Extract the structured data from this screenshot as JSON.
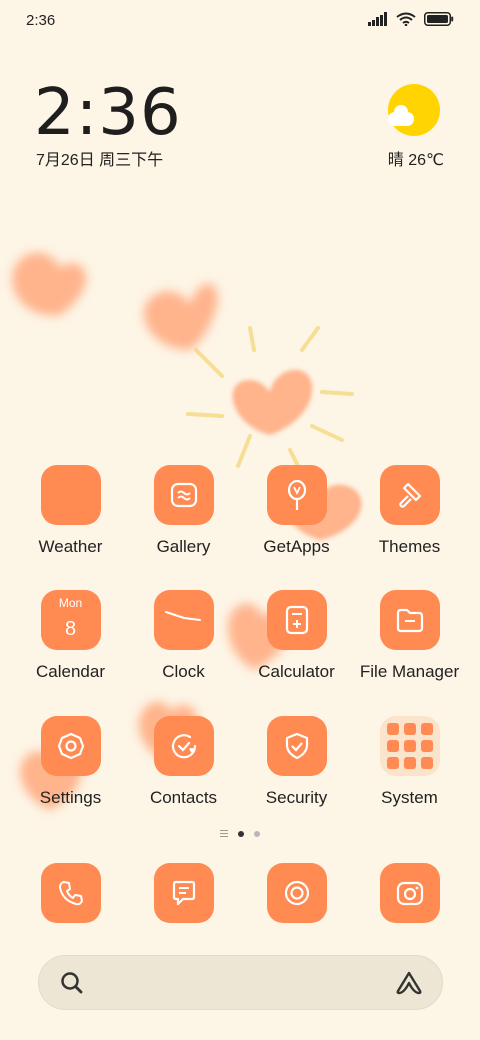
{
  "status_bar": {
    "time": "2:36",
    "signal_icon": "signal-icon",
    "wifi_icon": "wifi-icon",
    "battery_icon": "battery-icon"
  },
  "clock_widget": {
    "time": "2:36",
    "date": "7月26日 周三下午"
  },
  "weather_widget": {
    "icon": "partly-sunny-icon",
    "text": "晴 26℃"
  },
  "apps": [
    {
      "label": "Weather",
      "icon": "weather-icon"
    },
    {
      "label": "Gallery",
      "icon": "gallery-icon"
    },
    {
      "label": "GetApps",
      "icon": "getapps-icon"
    },
    {
      "label": "Themes",
      "icon": "themes-icon"
    },
    {
      "label": "Calendar",
      "icon": "calendar-icon",
      "month": "Mon",
      "day": "8"
    },
    {
      "label": "Clock",
      "icon": "clock-icon"
    },
    {
      "label": "Calculator",
      "icon": "calculator-icon"
    },
    {
      "label": "File Manager",
      "icon": "file-manager-icon"
    },
    {
      "label": "Settings",
      "icon": "settings-icon"
    },
    {
      "label": "Contacts",
      "icon": "contacts-icon"
    },
    {
      "label": "Security",
      "icon": "security-icon"
    },
    {
      "label": "System",
      "icon": "system-folder-icon"
    }
  ],
  "dock": [
    {
      "icon": "phone-icon"
    },
    {
      "icon": "messages-icon"
    },
    {
      "icon": "browser-icon"
    },
    {
      "icon": "camera-icon"
    }
  ],
  "page_indicator": {
    "pages": 2,
    "active": 0
  },
  "search_bar": {
    "search_icon": "search-icon",
    "assistant_icon": "assistant-icon"
  },
  "colors": {
    "background": "#fdf5e6",
    "accent": "#ff8a52",
    "sun": "#ffd400",
    "heart": "#ffb48c"
  }
}
